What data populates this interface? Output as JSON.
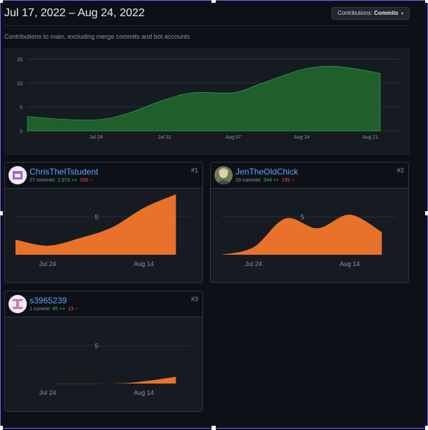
{
  "header": {
    "title": "Jul 17, 2022 – Aug 24, 2022",
    "dropdown_prefix": "Contributions:",
    "dropdown_value": "Commits",
    "dropdown_caret": "▾"
  },
  "subtitle": "Contributions to main, excluding merge commits and bot accounts",
  "colors": {
    "overview_fill": "#1e5f2c",
    "overview_stroke": "#2ea043",
    "contributor_fill": "#e8722a",
    "background": "#0d1117",
    "panel": "#161b22",
    "link": "#58a6ff",
    "additions": "#3fb950",
    "deletions": "#f85149"
  },
  "chart_data": [
    {
      "type": "area",
      "title": "",
      "xlabel": "",
      "ylabel": "",
      "ylim": [
        0,
        15
      ],
      "y_ticks": [
        "0",
        "5",
        "10",
        "15"
      ],
      "x_ticks": [
        "Jul 24",
        "Jul 31",
        "Aug 07",
        "Aug 14",
        "Aug 21"
      ],
      "series": [
        {
          "values": [
            {
              "x": "Jul 17",
              "y": 3
            },
            {
              "x": "Jul 20",
              "y": 2.5
            },
            {
              "x": "Jul 24",
              "y": 2.3
            },
            {
              "x": "Jul 27",
              "y": 3.5
            },
            {
              "x": "Jul 31",
              "y": 6.5
            },
            {
              "x": "Aug 03",
              "y": 8
            },
            {
              "x": "Aug 07",
              "y": 8
            },
            {
              "x": "Aug 10",
              "y": 10
            },
            {
              "x": "Aug 14",
              "y": 12.8
            },
            {
              "x": "Aug 17",
              "y": 13.5
            },
            {
              "x": "Aug 20",
              "y": 12.8
            },
            {
              "x": "Aug 22",
              "y": 12
            }
          ]
        }
      ],
      "grid": true
    },
    {
      "type": "area",
      "ylim": [
        0,
        8
      ],
      "y_ticks": [
        "5"
      ],
      "x_ticks": [
        "Jul 24",
        "Aug 14"
      ],
      "series": [
        {
          "values": [
            {
              "x": "Jul 17",
              "y": 2
            },
            {
              "x": "Jul 24",
              "y": 1.2
            },
            {
              "x": "Jul 31",
              "y": 2.2
            },
            {
              "x": "Aug 07",
              "y": 3.6
            },
            {
              "x": "Aug 14",
              "y": 6.2
            },
            {
              "x": "Aug 21",
              "y": 8
            }
          ]
        }
      ]
    },
    {
      "type": "area",
      "ylim": [
        0,
        8
      ],
      "y_ticks": [
        "5"
      ],
      "x_ticks": [
        "Jul 24",
        "Aug 14"
      ],
      "series": [
        {
          "values": [
            {
              "x": "Jul 17",
              "y": 0
            },
            {
              "x": "Jul 24",
              "y": 1
            },
            {
              "x": "Jul 31",
              "y": 4.8
            },
            {
              "x": "Aug 07",
              "y": 3.5
            },
            {
              "x": "Aug 14",
              "y": 5.3
            },
            {
              "x": "Aug 21",
              "y": 3
            }
          ]
        }
      ]
    },
    {
      "type": "area",
      "ylim": [
        0,
        8
      ],
      "y_ticks": [
        "5"
      ],
      "x_ticks": [
        "Jul 24",
        "Aug 14"
      ],
      "series": [
        {
          "values": [
            {
              "x": "Jul 17",
              "y": 0
            },
            {
              "x": "Aug 07",
              "y": 0
            },
            {
              "x": "Aug 14",
              "y": 0.3
            },
            {
              "x": "Aug 21",
              "y": 0.9
            }
          ]
        }
      ]
    }
  ],
  "contributors": [
    {
      "name": "ChrisTheITstudent",
      "commits": "27 commits",
      "additions": "2,973 ++",
      "deletions": "336 --",
      "rank": "#1",
      "avatar_icon": "identicon-avatar-icon"
    },
    {
      "name": "JenTheOldChick",
      "commits": "19 commits",
      "additions": "344 ++",
      "deletions": "195 --",
      "rank": "#2",
      "avatar_icon": "photo-avatar-icon"
    },
    {
      "name": "s3965239",
      "commits": "1 commit",
      "additions": "65 ++",
      "deletions": "13 --",
      "rank": "#3",
      "avatar_icon": "identicon-avatar-icon"
    }
  ]
}
